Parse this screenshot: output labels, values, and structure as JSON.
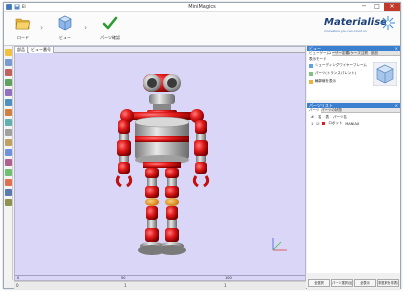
{
  "window": {
    "title": "MiniMagics",
    "quick_access_label": "El",
    "minimize_glyph": "─",
    "maximize_glyph": "□",
    "close_glyph": "✕"
  },
  "ribbon": {
    "steps": [
      {
        "label": "ロード",
        "icon": "folder-open-icon"
      },
      {
        "label": "ビュー",
        "icon": "cube-view-icon"
      },
      {
        "label": "パーツ確認",
        "icon": "checkmark-icon"
      }
    ],
    "arrow_glyph": "›",
    "logo": {
      "name": "Materialise",
      "tagline": "innovators you can count on"
    }
  },
  "left_toolbar": {
    "tools": [
      "select-tool-icon",
      "cursor-icon",
      "ruler-icon",
      "measure-icon",
      "view-front-icon",
      "view-back-icon",
      "view-left-icon",
      "view-right-icon",
      "view-top-icon",
      "view-bottom-icon",
      "zoom-icon",
      "pan-icon",
      "rotate-icon",
      "section-icon",
      "light-icon",
      "shade-icon"
    ]
  },
  "viewport": {
    "tabs": [
      "部品",
      "ビュー番号"
    ],
    "ruler_ticks": [
      "0",
      "50",
      "100"
    ],
    "axes": {
      "x_color": "#e04040",
      "y_color": "#40c040",
      "z_color": "#4060e0"
    }
  },
  "right_panel": {
    "view_panel": {
      "title": "ビュー",
      "close_glyph": "×",
      "tabs": [
        "ビューゲーム",
        "ユーザー定義",
        "スケーズ",
        "注釈",
        "部品"
      ],
      "section_label": "表示モード",
      "items": [
        {
          "label": "シェーディングワイヤーフレーム"
        },
        {
          "label": "パーツ(トランスパレント)"
        },
        {
          "label": "輪郭線を表示"
        }
      ]
    },
    "parts_panel": {
      "title": "パーツリスト",
      "close_glyph": "×",
      "tabs": [
        "パーツ",
        "パーツの状態"
      ],
      "columns": [
        "#",
        "名",
        "表",
        "パーツ名"
      ],
      "rows": [
        {
          "num": "1",
          "visible": "☑",
          "color": "#d02020",
          "name": "ロボット",
          "name2": "MANIAX"
        }
      ]
    },
    "bottom_buttons": [
      "全選択",
      "パーツ選択(反転)",
      "全表示",
      "非選択を非表示"
    ]
  },
  "status_bar": {
    "left": "0",
    "mid": "1",
    "right": "1"
  }
}
